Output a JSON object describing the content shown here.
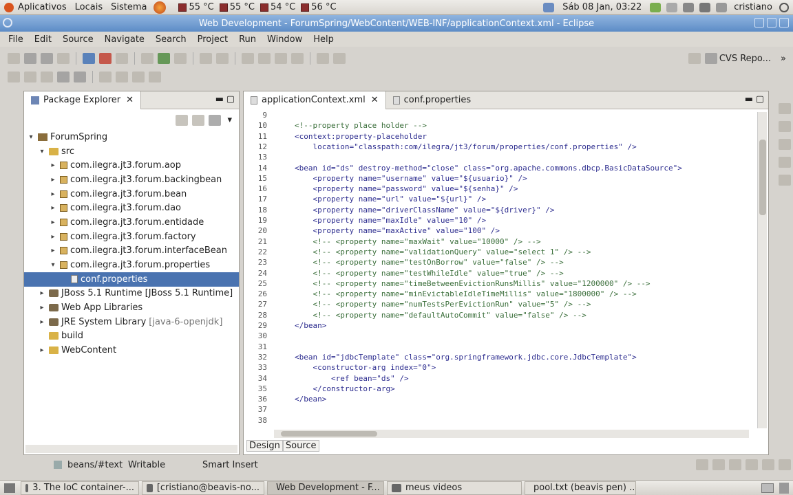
{
  "top_panel": {
    "menus": [
      "Aplicativos",
      "Locais",
      "Sistema"
    ],
    "temps": [
      "55 °C",
      "55 °C",
      "54 °C",
      "56 °C"
    ],
    "clock": "Sáb 08 Jan, 03:22",
    "user": "cristiano"
  },
  "window_title": "Web Development - ForumSpring/WebContent/WEB-INF/applicationContext.xml - Eclipse",
  "menubar": [
    "File",
    "Edit",
    "Source",
    "Navigate",
    "Search",
    "Project",
    "Run",
    "Window",
    "Help"
  ],
  "perspective": "CVS Repo...",
  "package_explorer": {
    "title": "Package Explorer",
    "items": [
      {
        "label": "ForumSpring",
        "depth": 0,
        "arrow": "▾",
        "icon": "project"
      },
      {
        "label": "src",
        "depth": 1,
        "arrow": "▾",
        "icon": "folder"
      },
      {
        "label": "com.ilegra.jt3.forum.aop",
        "depth": 2,
        "arrow": "▸",
        "icon": "package"
      },
      {
        "label": "com.ilegra.jt3.forum.backingbean",
        "depth": 2,
        "arrow": "▸",
        "icon": "package"
      },
      {
        "label": "com.ilegra.jt3.forum.bean",
        "depth": 2,
        "arrow": "▸",
        "icon": "package"
      },
      {
        "label": "com.ilegra.jt3.forum.dao",
        "depth": 2,
        "arrow": "▸",
        "icon": "package"
      },
      {
        "label": "com.ilegra.jt3.forum.entidade",
        "depth": 2,
        "arrow": "▸",
        "icon": "package"
      },
      {
        "label": "com.ilegra.jt3.forum.factory",
        "depth": 2,
        "arrow": "▸",
        "icon": "package"
      },
      {
        "label": "com.ilegra.jt3.forum.interfaceBean",
        "depth": 2,
        "arrow": "▸",
        "icon": "package"
      },
      {
        "label": "com.ilegra.jt3.forum.properties",
        "depth": 2,
        "arrow": "▾",
        "icon": "package"
      },
      {
        "label": "conf.properties",
        "depth": 3,
        "arrow": "",
        "icon": "file",
        "selected": true
      },
      {
        "label": "JBoss 5.1 Runtime [JBoss 5.1 Runtime]",
        "depth": 1,
        "arrow": "▸",
        "icon": "lib"
      },
      {
        "label": "Web App Libraries",
        "depth": 1,
        "arrow": "▸",
        "icon": "lib"
      },
      {
        "label": "JRE System Library",
        "suffix": "[java-6-openjdk]",
        "depth": 1,
        "arrow": "▸",
        "icon": "lib"
      },
      {
        "label": "build",
        "depth": 1,
        "arrow": "",
        "icon": "folder"
      },
      {
        "label": "WebContent",
        "depth": 1,
        "arrow": "▸",
        "icon": "folder"
      }
    ]
  },
  "editor": {
    "tabs": [
      {
        "label": "applicationContext.xml",
        "active": true
      },
      {
        "label": "conf.properties",
        "active": false
      }
    ],
    "lines": [
      {
        "n": "9",
        "t": ""
      },
      {
        "n": "10",
        "t": "<!--property place holder -->",
        "c": "cmt"
      },
      {
        "n": "11",
        "t": "<context:property-placeholder"
      },
      {
        "n": "12",
        "t": "    location=\"classpath:com/ilegra/jt3/forum/properties/conf.properties\" />"
      },
      {
        "n": "13",
        "t": ""
      },
      {
        "n": "14",
        "t": "<bean id=\"ds\" destroy-method=\"close\" class=\"org.apache.commons.dbcp.BasicDataSource\">"
      },
      {
        "n": "15",
        "t": "    <property name=\"username\" value=\"${usuario}\" />"
      },
      {
        "n": "16",
        "t": "    <property name=\"password\" value=\"${senha}\" />"
      },
      {
        "n": "17",
        "t": "    <property name=\"url\" value=\"${url}\" />"
      },
      {
        "n": "18",
        "t": "    <property name=\"driverClassName\" value=\"${driver}\" />"
      },
      {
        "n": "19",
        "t": "    <property name=\"maxIdle\" value=\"10\" />"
      },
      {
        "n": "20",
        "t": "    <property name=\"maxActive\" value=\"100\" />"
      },
      {
        "n": "21",
        "t": "    <!-- <property name=\"maxWait\" value=\"10000\" /> -->",
        "c": "cmt"
      },
      {
        "n": "22",
        "t": "    <!-- <property name=\"validationQuery\" value=\"select 1\" /> -->",
        "c": "cmt"
      },
      {
        "n": "23",
        "t": "    <!-- <property name=\"testOnBorrow\" value=\"false\" /> -->",
        "c": "cmt"
      },
      {
        "n": "24",
        "t": "    <!-- <property name=\"testWhileIdle\" value=\"true\" /> -->",
        "c": "cmt"
      },
      {
        "n": "25",
        "t": "    <!-- <property name=\"timeBetweenEvictionRunsMillis\" value=\"1200000\" /> -->",
        "c": "cmt"
      },
      {
        "n": "26",
        "t": "    <!-- <property name=\"minEvictableIdleTimeMillis\" value=\"1800000\" /> -->",
        "c": "cmt"
      },
      {
        "n": "27",
        "t": "    <!-- <property name=\"numTestsPerEvictionRun\" value=\"5\" /> -->",
        "c": "cmt"
      },
      {
        "n": "28",
        "t": "    <!-- <property name=\"defaultAutoCommit\" value=\"false\" /> -->",
        "c": "cmt"
      },
      {
        "n": "29",
        "t": "</bean>"
      },
      {
        "n": "30",
        "t": ""
      },
      {
        "n": "31",
        "t": ""
      },
      {
        "n": "32",
        "t": "<bean id=\"jdbcTemplate\" class=\"org.springframework.jdbc.core.JdbcTemplate\">"
      },
      {
        "n": "33",
        "t": "    <constructor-arg index=\"0\">"
      },
      {
        "n": "34",
        "t": "        <ref bean=\"ds\" />"
      },
      {
        "n": "35",
        "t": "    </constructor-arg>"
      },
      {
        "n": "36",
        "t": "</bean>"
      },
      {
        "n": "37",
        "t": ""
      },
      {
        "n": "38",
        "t": ""
      }
    ],
    "bottom_tabs": [
      "Design",
      "Source"
    ]
  },
  "status": {
    "path": "beans/#text",
    "mode": "Writable",
    "insert": "Smart Insert"
  },
  "taskbar": [
    {
      "label": "3. The IoC container-...",
      "active": false
    },
    {
      "label": "[cristiano@beavis-no...",
      "active": false
    },
    {
      "label": "Web Development - F...",
      "active": true
    },
    {
      "label": "meus videos",
      "active": false
    },
    {
      "label": "pool.txt (beavis pen) ...",
      "active": false
    }
  ]
}
